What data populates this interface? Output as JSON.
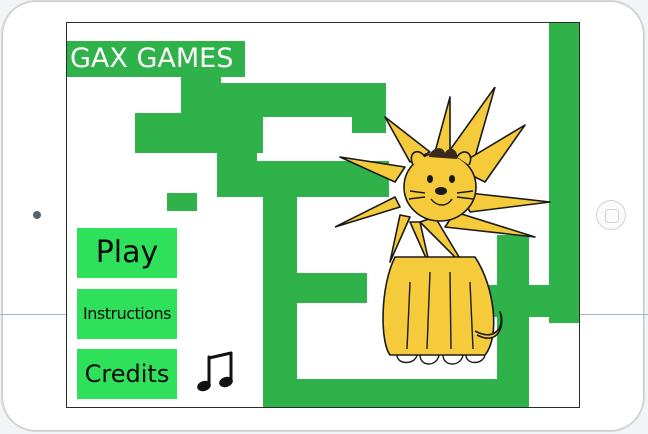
{
  "game": {
    "brand": "GAX GAMES",
    "menu": {
      "play": "Play",
      "instructions": "Instructions",
      "credits": "Credits"
    },
    "sound_icon": "music-notes-icon",
    "mascot": "lion-character"
  },
  "colors": {
    "maze_green": "#2fb24a",
    "button_green": "#2fe05a",
    "lion_yellow": "#f5cb3b",
    "outline": "#1a1a1a"
  }
}
